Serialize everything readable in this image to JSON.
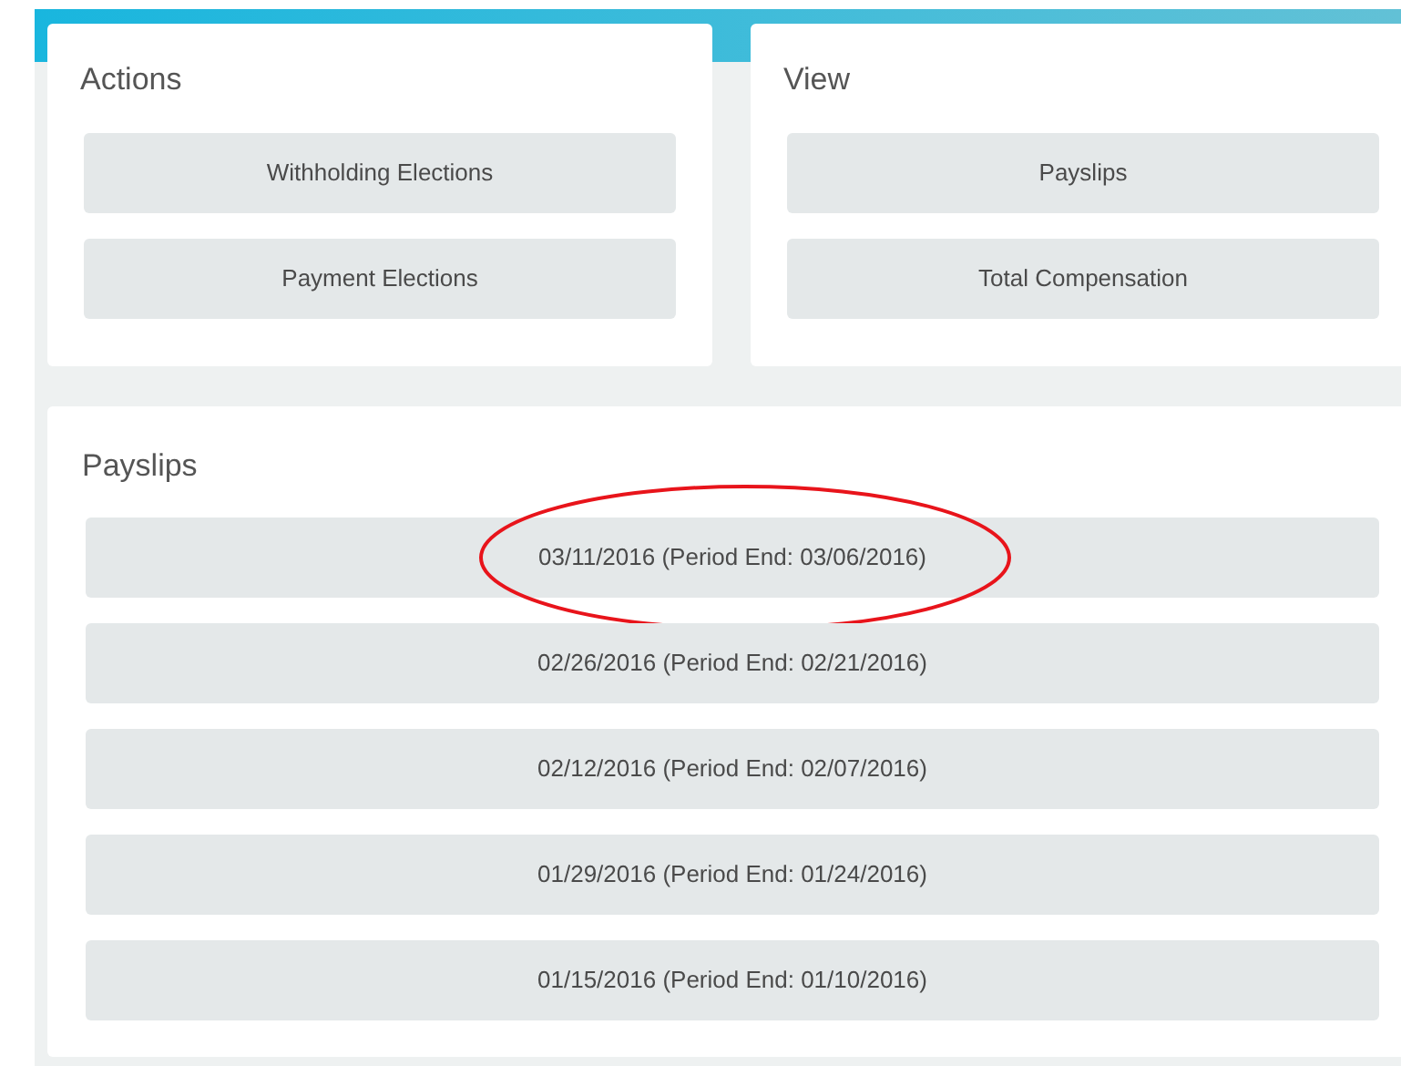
{
  "actions": {
    "title": "Actions",
    "buttons": [
      "Withholding Elections",
      "Payment Elections"
    ]
  },
  "view": {
    "title": "View",
    "buttons": [
      "Payslips",
      "Total Compensation"
    ]
  },
  "payslips": {
    "title": "Payslips",
    "rows": [
      {
        "label": "03/11/2016 (Period End: 03/06/2016)",
        "circled": true
      },
      {
        "label": "02/26/2016 (Period End: 02/21/2016)",
        "circled": false
      },
      {
        "label": "02/12/2016 (Period End: 02/07/2016)",
        "circled": false
      },
      {
        "label": "01/29/2016 (Period End: 01/24/2016)",
        "circled": false
      },
      {
        "label": "01/15/2016 (Period End: 01/10/2016)",
        "circled": false
      }
    ]
  }
}
